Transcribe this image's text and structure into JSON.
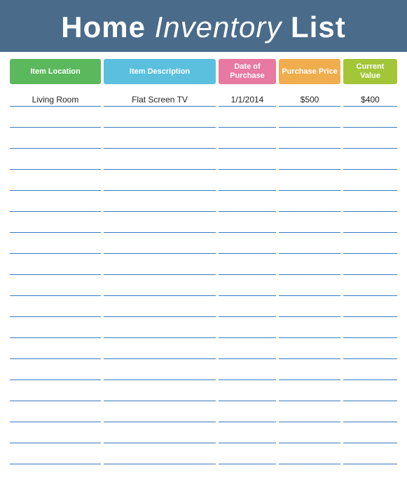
{
  "header": {
    "title_part1": "Home ",
    "title_cursive": "Inventory",
    "title_part2": " List"
  },
  "columns": {
    "location": "Item Location",
    "description": "Item Description",
    "date": "Date of Purchase",
    "purchase_price": "Purchase Price",
    "current_value": "Current Value"
  },
  "rows": [
    {
      "location": "Living Room",
      "description": "Flat Screen TV",
      "date": "1/1/2014",
      "purchase_price": "$500",
      "current_value": "$400"
    },
    {
      "location": "",
      "description": "",
      "date": "",
      "purchase_price": "",
      "current_value": ""
    },
    {
      "location": "",
      "description": "",
      "date": "",
      "purchase_price": "",
      "current_value": ""
    },
    {
      "location": "",
      "description": "",
      "date": "",
      "purchase_price": "",
      "current_value": ""
    },
    {
      "location": "",
      "description": "",
      "date": "",
      "purchase_price": "",
      "current_value": ""
    },
    {
      "location": "",
      "description": "",
      "date": "",
      "purchase_price": "",
      "current_value": ""
    },
    {
      "location": "",
      "description": "",
      "date": "",
      "purchase_price": "",
      "current_value": ""
    },
    {
      "location": "",
      "description": "",
      "date": "",
      "purchase_price": "",
      "current_value": ""
    },
    {
      "location": "",
      "description": "",
      "date": "",
      "purchase_price": "",
      "current_value": ""
    },
    {
      "location": "",
      "description": "",
      "date": "",
      "purchase_price": "",
      "current_value": ""
    },
    {
      "location": "",
      "description": "",
      "date": "",
      "purchase_price": "",
      "current_value": ""
    },
    {
      "location": "",
      "description": "",
      "date": "",
      "purchase_price": "",
      "current_value": ""
    },
    {
      "location": "",
      "description": "",
      "date": "",
      "purchase_price": "",
      "current_value": ""
    },
    {
      "location": "",
      "description": "",
      "date": "",
      "purchase_price": "",
      "current_value": ""
    },
    {
      "location": "",
      "description": "",
      "date": "",
      "purchase_price": "",
      "current_value": ""
    },
    {
      "location": "",
      "description": "",
      "date": "",
      "purchase_price": "",
      "current_value": ""
    },
    {
      "location": "",
      "description": "",
      "date": "",
      "purchase_price": "",
      "current_value": ""
    },
    {
      "location": "",
      "description": "",
      "date": "",
      "purchase_price": "",
      "current_value": ""
    }
  ]
}
